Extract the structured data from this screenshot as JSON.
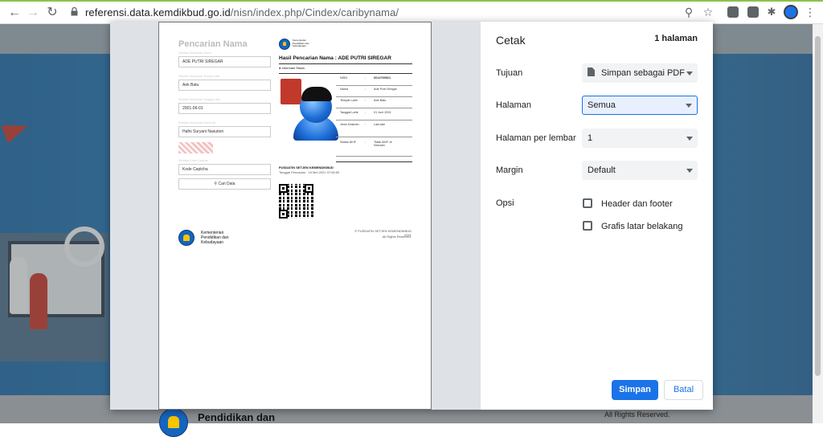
{
  "browser": {
    "url_host": "referensi.data.kemdikbud.go.id",
    "url_path": "/nisn/index.php/Cindex/caribynama/",
    "toolbar_icons": [
      "back-icon",
      "forward-icon",
      "reload-icon",
      "lock-icon",
      "zoom-icon",
      "star-icon",
      "extension-icon",
      "puzzle-icon",
      "profile-avatar",
      "menu-icon"
    ]
  },
  "background_page": {
    "footer_title": "Pendidikan dan",
    "footer_right": "All Rights Reserved."
  },
  "print_dialog": {
    "title": "Cetak",
    "page_count": "1 halaman",
    "destination_label": "Tujuan",
    "destination_value": "Simpan sebagai PDF",
    "pages_label": "Halaman",
    "pages_value": "Semua",
    "pages_per_sheet_label": "Halaman per lembar",
    "pages_per_sheet_value": "1",
    "margin_label": "Margin",
    "margin_value": "Default",
    "options_label": "Opsi",
    "option_header_footer": "Header dan footer",
    "option_background": "Grafis latar belakang",
    "save_button": "Simpan",
    "cancel_button": "Batal"
  },
  "preview": {
    "search_heading": "Pencarian Nama",
    "field_label_name": "Silahkan Masukkan Nama",
    "field_name": "ADE PUTRI SIREGAR",
    "field_label_place": "Silahkan Masukkan Tempat Lahir",
    "field_place": "Aek Batu",
    "field_label_date": "Silahkan Masukkan Tanggal Lahir",
    "field_date": "2001-06-01",
    "field_label_mother": "Silahkan Masukkan Nama Ibu",
    "field_mother": "Hafni Suryani Nasution",
    "field_label_captcha": "Silahkan Kode Captcha",
    "field_captcha": "Kode Captcha",
    "search_button": "Cari Data",
    "ministry_line1": "Kementerian",
    "ministry_line2": "Pendidikan dan",
    "ministry_line3": "Kebudayaan",
    "result_title": "Hasil Pencarian Nama : ADE PUTRI SIREGAR",
    "student_info_tab": "Informasi Siswa",
    "rows": [
      {
        "k": "NISN",
        "v": "0014799521"
      },
      {
        "k": "Nama",
        "v": "Ade Putri Siregar"
      },
      {
        "k": "Tempat Lahir",
        "v": "Aek Batu"
      },
      {
        "k": "Tanggal Lahir",
        "v": "01 Juni 2001"
      },
      {
        "k": "Jenis Kelamin",
        "v": "Laki-laki"
      },
      {
        "k": "Status AKIF",
        "v": "Tidak AKIF di Sekolah"
      }
    ],
    "source_title": "PUSDATIN SETJEN KEMENDIKBUD",
    "search_date": "Tanggal Pencarian : 15 Mei 2021 07:08:59",
    "copyright": "© PUSDATIN SETJEN KEMENDIKBUD 2021",
    "rights": "All Rights Reserved."
  },
  "colors": {
    "accent": "#1a73e8",
    "hero_blue": "#2b82bd",
    "tab_loading": "#8bc34a"
  }
}
